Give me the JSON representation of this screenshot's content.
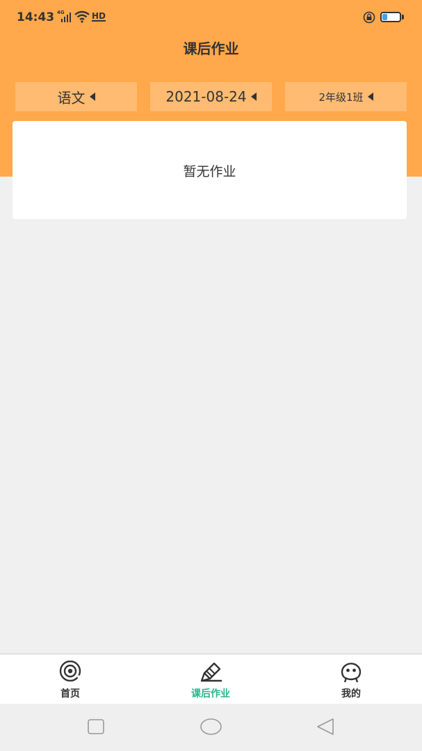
{
  "status_bar": {
    "time": "14:43",
    "network": "4G",
    "hd": "HD",
    "battery_level": 0.25,
    "battery_color": "#3fa3e8",
    "icons": [
      "signal-icon",
      "wifi-icon",
      "hd-icon",
      "rotation-lock-icon",
      "battery-icon"
    ]
  },
  "header": {
    "title": "课后作业",
    "background": "#ffa84c"
  },
  "filters": {
    "subject": "语文",
    "date": "2021-08-24",
    "class": "2年级1班"
  },
  "content": {
    "empty_text": "暂无作业"
  },
  "tabs": [
    {
      "label": "首页",
      "icon": "home-eye-icon",
      "active": false
    },
    {
      "label": "课后作业",
      "icon": "pencil-icon",
      "active": true
    },
    {
      "label": "我的",
      "icon": "profile-face-icon",
      "active": false
    }
  ],
  "colors": {
    "accent": "#ffa84c",
    "filter_bg": "#ffbb72",
    "active_tab": "#2bb58a",
    "page_bg": "#f0f0f0"
  },
  "system_nav": [
    "recent-apps-button",
    "home-button",
    "back-button"
  ]
}
